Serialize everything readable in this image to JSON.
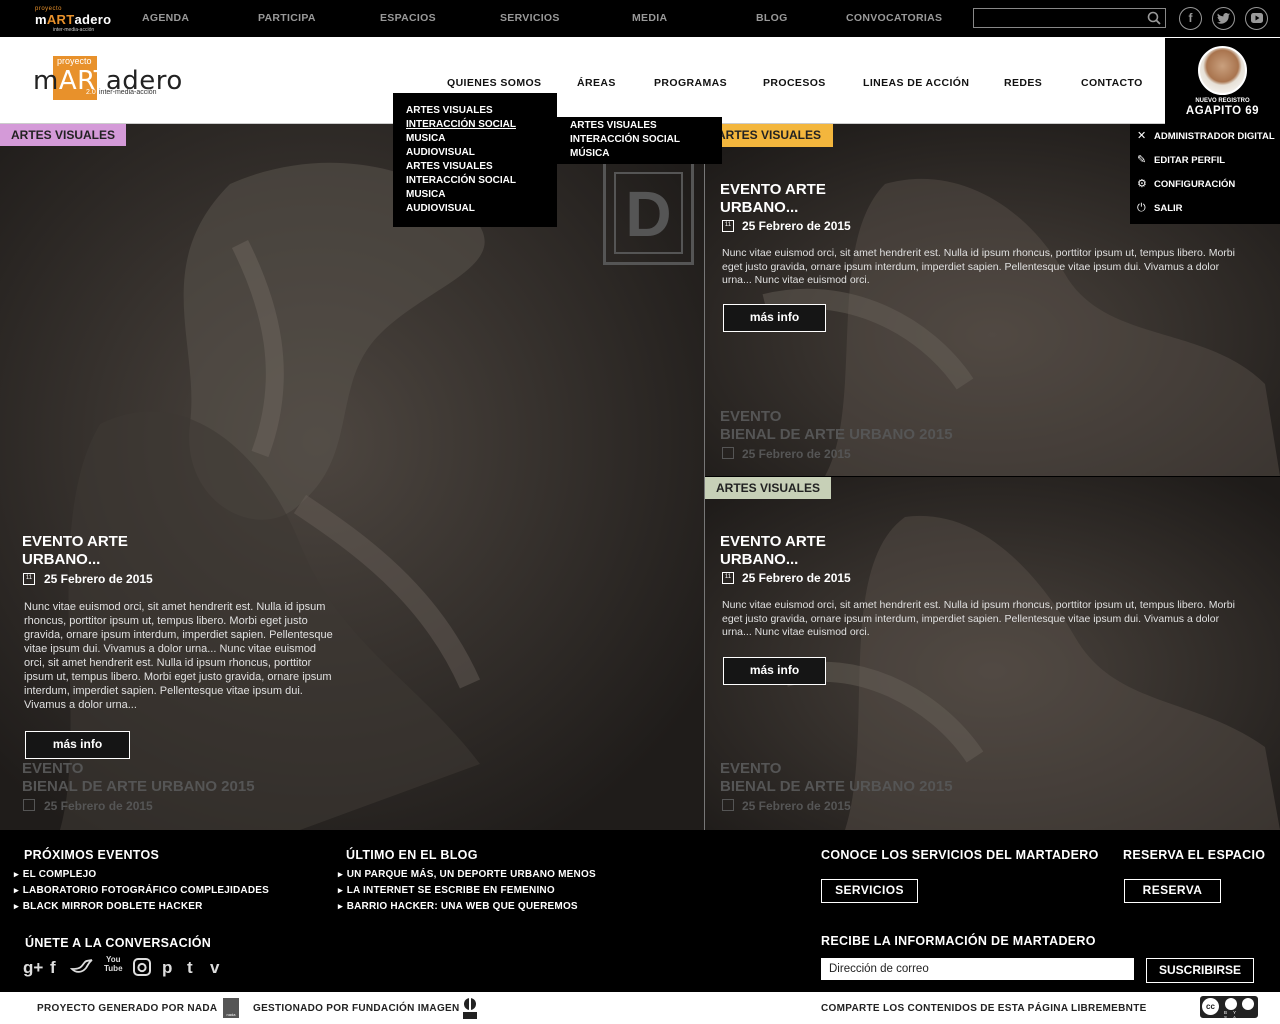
{
  "topbar": {
    "logo": {
      "top": "proyecto",
      "mark_a": "m",
      "mark_b": "ART",
      "mark_c": "adero",
      "sub": "inter-media-acción"
    },
    "nav": [
      "AGENDA",
      "PARTICIPA",
      "ESPACIOS",
      "SERVICIOS",
      "MEDIA",
      "BLOG",
      "CONVOCATORIAS"
    ],
    "search_placeholder": "",
    "social": [
      "facebook-icon",
      "twitter-icon",
      "youtube-icon"
    ]
  },
  "header": {
    "logo": {
      "top": "proyecto",
      "mark_a": "m",
      "mark_b": "ART",
      "mark_c": "adero",
      "version": "2.0",
      "sub": "inter-media-acción"
    },
    "nav": [
      "QUIENES SOMOS",
      "ÁREAS",
      "PROGRAMAS",
      "PROCESOS",
      "LINEAS DE ACCIÓN",
      "REDES",
      "CONTACTO"
    ]
  },
  "user": {
    "label": "NUEVO REGISTRO",
    "name": "AGAPITO 69"
  },
  "user_menu": [
    {
      "label": "ADMINISTRADOR DIGITAL",
      "icon": "tools-icon"
    },
    {
      "label": "EDITAR PERFIL",
      "icon": "edit-icon"
    },
    {
      "label": "CONFIGURACIÓN",
      "icon": "gear-icon"
    },
    {
      "label": "SALIR",
      "icon": "power-icon"
    }
  ],
  "dropdown_areas": [
    "ARTES VISUALES",
    "INTERACCIÓN SOCIAL",
    "MUSICA",
    "AUDIOVISUAL",
    "ARTES VISUALES",
    "INTERACCIÓN SOCIAL",
    "MUSICA",
    "AUDIOVISUAL"
  ],
  "dropdown_sub": [
    "ARTES VISUALES",
    "INTERACCIÓN SOCIAL",
    "MÚSICA"
  ],
  "panels": [
    {
      "tag": "ARTES VISUALES",
      "tag_color": "#d49ad8",
      "title_1": "EVENTO ARTE",
      "title_2": "URBANO...",
      "date": "25 Febrero de 2015",
      "text": "Nunc vitae euismod orci, sit amet hendrerit est. Nulla id ipsum rhoncus, porttitor ipsum ut, tempus libero. Morbi eget justo gravida, ornare ipsum interdum, imperdiet sapien. Pellentesque vitae ipsum dui. Vivamus a dolor urna... Nunc vitae euismod orci, sit amet hendrerit est. Nulla id ipsum rhoncus, porttitor ipsum ut, tempus libero. Morbi eget justo gravida, ornare ipsum interdum, imperdiet sapien. Pellentesque vitae ipsum dui. Vivamus a dolor urna...",
      "button": "más info",
      "next_1": "EVENTO",
      "next_2": "BIENAL DE ARTE URBANO 2015",
      "next_date": "25 Febrero de 2015"
    },
    {
      "tag": "ARTES VISUALES",
      "tag_color": "#f3b63d",
      "title_1": "EVENTO ARTE",
      "title_2": "URBANO...",
      "date": "25 Febrero de 2015",
      "text": "Nunc vitae euismod orci, sit amet hendrerit est. Nulla id ipsum rhoncus, porttitor ipsum ut, tempus libero. Morbi eget justo gravida, ornare ipsum interdum, imperdiet sapien. Pellentesque vitae ipsum dui. Vivamus a dolor urna... Nunc vitae euismod orci.",
      "button": "más info",
      "next_1": "EVENTO",
      "next_2": "BIENAL DE ARTE URBANO 2015",
      "next_date": "25 Febrero de 2015"
    },
    {
      "tag": "ARTES VISUALES",
      "tag_color": "#c7d0b7",
      "title_1": "EVENTO ARTE",
      "title_2": "URBANO...",
      "date": "25 Febrero de 2015",
      "text": "Nunc vitae euismod orci, sit amet hendrerit est. Nulla id ipsum rhoncus, porttitor ipsum ut, tempus libero. Morbi eget justo gravida, ornare ipsum interdum, imperdiet sapien. Pellentesque vitae ipsum dui. Vivamus a dolor urna... Nunc vitae euismod orci.",
      "button": "más info",
      "next_1": "EVENTO",
      "next_2": "BIENAL DE ARTE URBANO 2015",
      "next_date": "25 Febrero de 2015"
    }
  ],
  "cal_day": "11",
  "badge_letter": "D",
  "footer": {
    "events_title": "PRÓXIMOS EVENTOS",
    "events": [
      "EL COMPLEJO",
      "LABORATORIO FOTOGRÁFICO COMPLEJIDADES",
      "BLACK MIRROR DOBLETE HACKER"
    ],
    "blog_title": "ÚLTIMO EN EL BLOG",
    "blog": [
      "UN PARQUE MÁS, UN DEPORTE URBANO MENOS",
      "LA INTERNET SE ESCRIBE EN FEMENINO",
      "BARRIO HACKER: UNA WEB QUE QUEREMOS"
    ],
    "services_title": "CONOCE LOS SERVICIOS DEL MARTADERO",
    "services_button": "SERVICIOS",
    "reserve_title": "RESERVA EL ESPACIO",
    "reserve_button": "RESERVA",
    "join_title": "ÚNETE A LA CONVERSACIÓN",
    "social": [
      "g+",
      "f",
      "bird",
      "You Tube",
      "instagram",
      "p",
      "t",
      "v"
    ],
    "newsletter_title": "RECIBE LA INFORMACIÓN DE MARTADERO",
    "email_placeholder": "Dirección de correo",
    "subscribe_button": "SUSCRIBIRSE"
  },
  "bottom": {
    "generated": "PROYECTO GENERADO POR NADA",
    "managed": "GESTIONADO POR FUNDACIÓN IMAGEN",
    "share": "COMPARTE LOS CONTENIDOS DE ESTA PÁGINA LIBREMEBNTE",
    "nada_logo_text": "nada",
    "cc_text": "BY SA"
  }
}
